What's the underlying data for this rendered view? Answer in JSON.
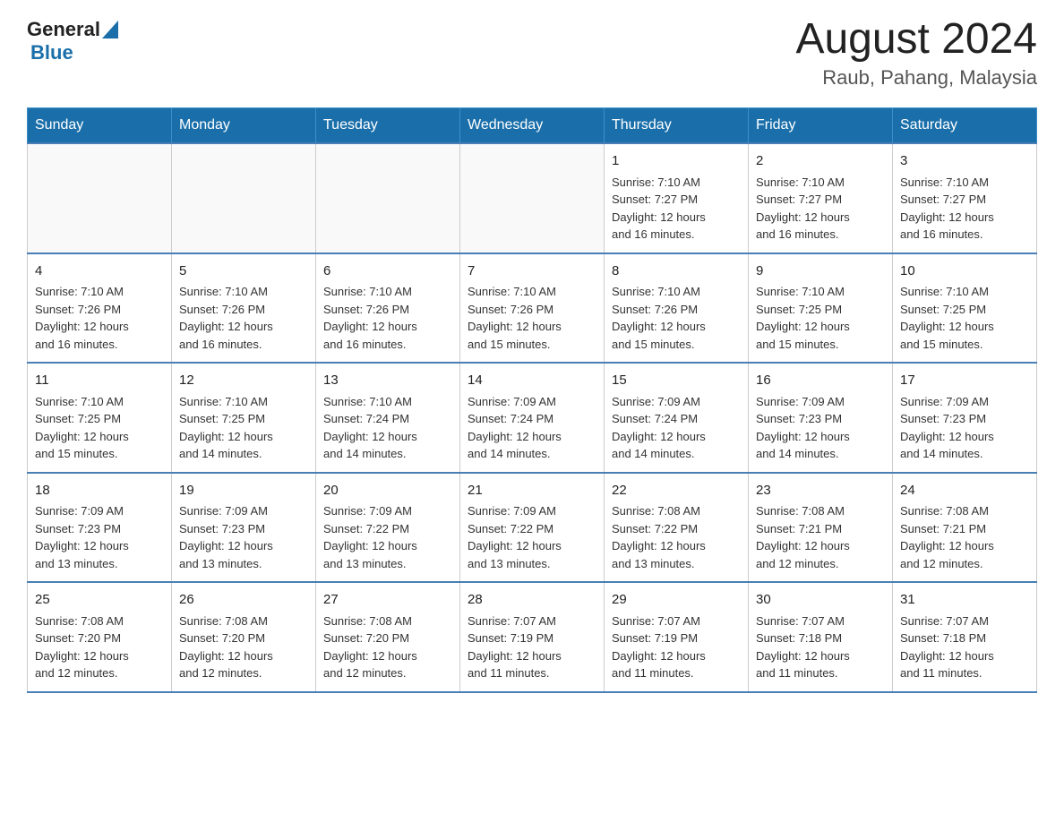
{
  "header": {
    "logo_general": "General",
    "logo_blue": "Blue",
    "month_year": "August 2024",
    "location": "Raub, Pahang, Malaysia"
  },
  "days_of_week": [
    "Sunday",
    "Monday",
    "Tuesday",
    "Wednesday",
    "Thursday",
    "Friday",
    "Saturday"
  ],
  "weeks": [
    [
      {
        "day": "",
        "info": ""
      },
      {
        "day": "",
        "info": ""
      },
      {
        "day": "",
        "info": ""
      },
      {
        "day": "",
        "info": ""
      },
      {
        "day": "1",
        "info": "Sunrise: 7:10 AM\nSunset: 7:27 PM\nDaylight: 12 hours\nand 16 minutes."
      },
      {
        "day": "2",
        "info": "Sunrise: 7:10 AM\nSunset: 7:27 PM\nDaylight: 12 hours\nand 16 minutes."
      },
      {
        "day": "3",
        "info": "Sunrise: 7:10 AM\nSunset: 7:27 PM\nDaylight: 12 hours\nand 16 minutes."
      }
    ],
    [
      {
        "day": "4",
        "info": "Sunrise: 7:10 AM\nSunset: 7:26 PM\nDaylight: 12 hours\nand 16 minutes."
      },
      {
        "day": "5",
        "info": "Sunrise: 7:10 AM\nSunset: 7:26 PM\nDaylight: 12 hours\nand 16 minutes."
      },
      {
        "day": "6",
        "info": "Sunrise: 7:10 AM\nSunset: 7:26 PM\nDaylight: 12 hours\nand 16 minutes."
      },
      {
        "day": "7",
        "info": "Sunrise: 7:10 AM\nSunset: 7:26 PM\nDaylight: 12 hours\nand 15 minutes."
      },
      {
        "day": "8",
        "info": "Sunrise: 7:10 AM\nSunset: 7:26 PM\nDaylight: 12 hours\nand 15 minutes."
      },
      {
        "day": "9",
        "info": "Sunrise: 7:10 AM\nSunset: 7:25 PM\nDaylight: 12 hours\nand 15 minutes."
      },
      {
        "day": "10",
        "info": "Sunrise: 7:10 AM\nSunset: 7:25 PM\nDaylight: 12 hours\nand 15 minutes."
      }
    ],
    [
      {
        "day": "11",
        "info": "Sunrise: 7:10 AM\nSunset: 7:25 PM\nDaylight: 12 hours\nand 15 minutes."
      },
      {
        "day": "12",
        "info": "Sunrise: 7:10 AM\nSunset: 7:25 PM\nDaylight: 12 hours\nand 14 minutes."
      },
      {
        "day": "13",
        "info": "Sunrise: 7:10 AM\nSunset: 7:24 PM\nDaylight: 12 hours\nand 14 minutes."
      },
      {
        "day": "14",
        "info": "Sunrise: 7:09 AM\nSunset: 7:24 PM\nDaylight: 12 hours\nand 14 minutes."
      },
      {
        "day": "15",
        "info": "Sunrise: 7:09 AM\nSunset: 7:24 PM\nDaylight: 12 hours\nand 14 minutes."
      },
      {
        "day": "16",
        "info": "Sunrise: 7:09 AM\nSunset: 7:23 PM\nDaylight: 12 hours\nand 14 minutes."
      },
      {
        "day": "17",
        "info": "Sunrise: 7:09 AM\nSunset: 7:23 PM\nDaylight: 12 hours\nand 14 minutes."
      }
    ],
    [
      {
        "day": "18",
        "info": "Sunrise: 7:09 AM\nSunset: 7:23 PM\nDaylight: 12 hours\nand 13 minutes."
      },
      {
        "day": "19",
        "info": "Sunrise: 7:09 AM\nSunset: 7:23 PM\nDaylight: 12 hours\nand 13 minutes."
      },
      {
        "day": "20",
        "info": "Sunrise: 7:09 AM\nSunset: 7:22 PM\nDaylight: 12 hours\nand 13 minutes."
      },
      {
        "day": "21",
        "info": "Sunrise: 7:09 AM\nSunset: 7:22 PM\nDaylight: 12 hours\nand 13 minutes."
      },
      {
        "day": "22",
        "info": "Sunrise: 7:08 AM\nSunset: 7:22 PM\nDaylight: 12 hours\nand 13 minutes."
      },
      {
        "day": "23",
        "info": "Sunrise: 7:08 AM\nSunset: 7:21 PM\nDaylight: 12 hours\nand 12 minutes."
      },
      {
        "day": "24",
        "info": "Sunrise: 7:08 AM\nSunset: 7:21 PM\nDaylight: 12 hours\nand 12 minutes."
      }
    ],
    [
      {
        "day": "25",
        "info": "Sunrise: 7:08 AM\nSunset: 7:20 PM\nDaylight: 12 hours\nand 12 minutes."
      },
      {
        "day": "26",
        "info": "Sunrise: 7:08 AM\nSunset: 7:20 PM\nDaylight: 12 hours\nand 12 minutes."
      },
      {
        "day": "27",
        "info": "Sunrise: 7:08 AM\nSunset: 7:20 PM\nDaylight: 12 hours\nand 12 minutes."
      },
      {
        "day": "28",
        "info": "Sunrise: 7:07 AM\nSunset: 7:19 PM\nDaylight: 12 hours\nand 11 minutes."
      },
      {
        "day": "29",
        "info": "Sunrise: 7:07 AM\nSunset: 7:19 PM\nDaylight: 12 hours\nand 11 minutes."
      },
      {
        "day": "30",
        "info": "Sunrise: 7:07 AM\nSunset: 7:18 PM\nDaylight: 12 hours\nand 11 minutes."
      },
      {
        "day": "31",
        "info": "Sunrise: 7:07 AM\nSunset: 7:18 PM\nDaylight: 12 hours\nand 11 minutes."
      }
    ]
  ]
}
